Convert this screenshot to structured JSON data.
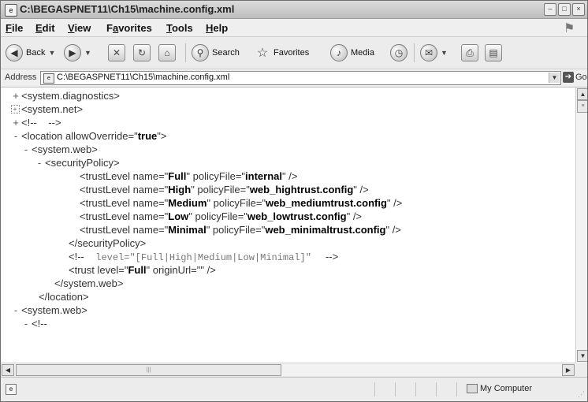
{
  "window": {
    "title": "C:\\BEGASPNET11\\Ch15\\machine.config.xml"
  },
  "menu": {
    "items": [
      {
        "mn": "F",
        "rest": "ile"
      },
      {
        "mn": "E",
        "rest": "dit"
      },
      {
        "mn": "V",
        "rest": "iew"
      },
      {
        "pre": "F",
        "mn": "a",
        "rest": "vorites"
      },
      {
        "mn": "T",
        "rest": "ools"
      },
      {
        "mn": "H",
        "rest": "elp"
      }
    ]
  },
  "toolbar": {
    "back_label": "Back",
    "search_label": "Search",
    "favorites_label": "Favorites",
    "media_label": "Media"
  },
  "address": {
    "label": "Address",
    "value": "C:\\BEGASPNET11\\Ch15\\machine.config.xml",
    "go_label": "Go"
  },
  "xml_lines": [
    {
      "marker": "+",
      "text": "<system.diagnostics>"
    },
    {
      "marker": "box",
      "text": "<system.net>"
    },
    {
      "marker": "+",
      "text": "<!--    -->"
    },
    {
      "marker": "-",
      "pre": "<location allowOverride=\"",
      "bold": "true",
      "post": "\">"
    },
    {
      "marker": "-",
      "text": "<system.web>"
    },
    {
      "marker": "-",
      "text": "<securityPolicy>"
    },
    {
      "pre": "<trustLevel name=\"",
      "bold": "Full",
      "mid": "\" policyFile=\"",
      "bold2": "internal",
      "post": "\" />"
    },
    {
      "pre": "<trustLevel name=\"",
      "bold": "High",
      "mid": "\" policyFile=\"",
      "bold2": "web_hightrust.config",
      "post": "\" />"
    },
    {
      "pre": "<trustLevel name=\"",
      "bold": "Medium",
      "mid": "\" policyFile=\"",
      "bold2": "web_mediumtrust.config",
      "post": "\" />"
    },
    {
      "pre": "<trustLevel name=\"",
      "bold": "Low",
      "mid": "\" policyFile=\"",
      "bold2": "web_lowtrust.config",
      "post": "\" />"
    },
    {
      "pre": "<trustLevel name=\"",
      "bold": "Minimal",
      "mid": "\" policyFile=\"",
      "bold2": "web_minimaltrust.config",
      "post": "\" />"
    },
    {
      "text": "</securityPolicy>"
    },
    {
      "comment_open": "<!--",
      "comment_body": "  level=\"[Full|High|Medium|Low|Minimal]\" ",
      "comment_close": "-->"
    },
    {
      "pre": "<trust level=\"",
      "bold": "Full",
      "post": "\" originUrl=\"\" />"
    },
    {
      "text": "</system.web>"
    },
    {
      "text": "</location>"
    },
    {
      "marker": "-",
      "text": "<system.web>"
    },
    {
      "marker": "-",
      "text": "<!--"
    }
  ],
  "status": {
    "zone": "My Computer"
  }
}
